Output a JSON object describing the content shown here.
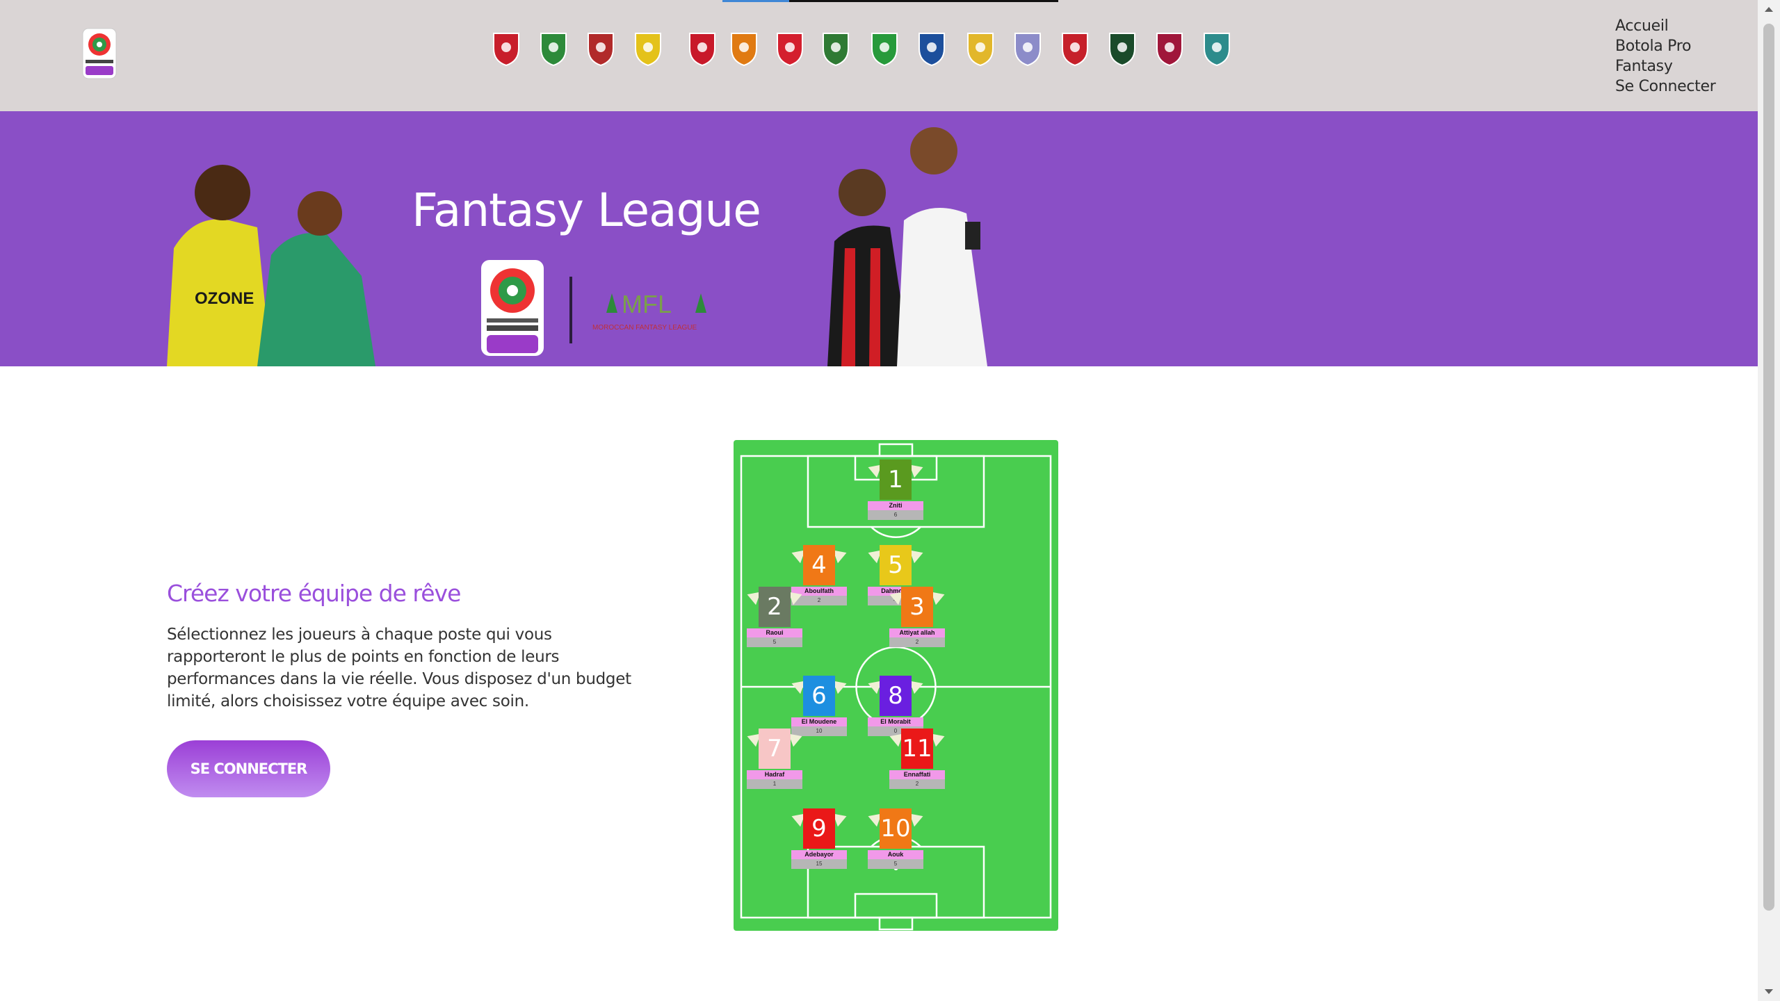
{
  "header": {
    "logo_icon": "botola-pro-inwi-logo-icon",
    "clubs": [
      {
        "icon": "wydad-crest-icon",
        "color": "#c81e2b"
      },
      {
        "icon": "raja-crest-icon",
        "color": "#2d8a3a"
      },
      {
        "icon": "olympique-safi-crest-icon",
        "color": "#b12a2a"
      },
      {
        "icon": "maghreb-fes-crest-icon",
        "color": "#e4c21a"
      },
      {
        "icon": "fus-rabat-red-crest-icon",
        "color": "#c8192a"
      },
      {
        "icon": "renaissance-berkane-crest-icon",
        "color": "#e07a12"
      },
      {
        "icon": "fus-crest-icon",
        "color": "#d41f2e"
      },
      {
        "icon": "far-rabat-crest-icon",
        "color": "#2f7a34"
      },
      {
        "icon": "rca-star-crest-icon",
        "color": "#279a3b"
      },
      {
        "icon": "irt-crest-icon",
        "color": "#1c4f9c"
      },
      {
        "icon": "dhj-crest-icon",
        "color": "#e2b72b"
      },
      {
        "icon": "moghreb-tetouan-crest-icon",
        "color": "#8c8cc9"
      },
      {
        "icon": "hassania-agadir-crest-icon",
        "color": "#c6202a"
      },
      {
        "icon": "jss-crest-icon",
        "color": "#1a4b2a"
      },
      {
        "icon": "chabab-mohammedia-crest-icon",
        "color": "#a0163a"
      },
      {
        "icon": "olympic-khouribga-crest-icon",
        "color": "#2d8c8c"
      }
    ],
    "nav": [
      "Accueil",
      "Botola Pro",
      "Fantasy",
      "Se Connecter"
    ]
  },
  "hero": {
    "title": "Fantasy League",
    "logo_text": "MFL",
    "logo_sub": "MOROCCAN FANTASY LEAGUE",
    "botola_logo": "botola-pro-inwi-large-logo-icon"
  },
  "main": {
    "subtitle": "Créez votre équipe de rêve",
    "description": "Sélectionnez les joueurs à chaque poste qui vous rapporteront le plus de points en fonction de leurs performances dans la vie réelle. Vous disposez d'un budget limité, alors choisissez votre équipe avec soin.",
    "cta_label": "SE CONNECTER"
  },
  "colors": {
    "header_bg": "#dad5d5",
    "hero_bg": "#8a4fc6",
    "accent": "#9a4fdc",
    "pitch": "#49cd4f"
  },
  "lineup": [
    {
      "number": "1",
      "name": "Zniti",
      "points": "6",
      "color": "#5a9a1f"
    },
    {
      "number": "4",
      "name": "Aboulfath",
      "points": "2",
      "color": "#f07816"
    },
    {
      "number": "5",
      "name": "Dahmoun",
      "points": "-1",
      "color": "#e8c81a"
    },
    {
      "number": "2",
      "name": "Raoui",
      "points": "5",
      "color": "#6a7a62"
    },
    {
      "number": "3",
      "name": "Attiyat allah",
      "points": "2",
      "color": "#f07816"
    },
    {
      "number": "6",
      "name": "El Moudene",
      "points": "10",
      "color": "#1d8fe0"
    },
    {
      "number": "8",
      "name": "El Morabit",
      "points": "0",
      "color": "#6a1fe0"
    },
    {
      "number": "7",
      "name": "Hadraf",
      "points": "1",
      "color": "#f7c6c6"
    },
    {
      "number": "11",
      "name": "Ennaffati",
      "points": "2",
      "color": "#ea1818"
    },
    {
      "number": "9",
      "name": "Adebayor",
      "points": "15",
      "color": "#ea1818"
    },
    {
      "number": "10",
      "name": "Aouk",
      "points": "5",
      "color": "#f07816"
    }
  ]
}
